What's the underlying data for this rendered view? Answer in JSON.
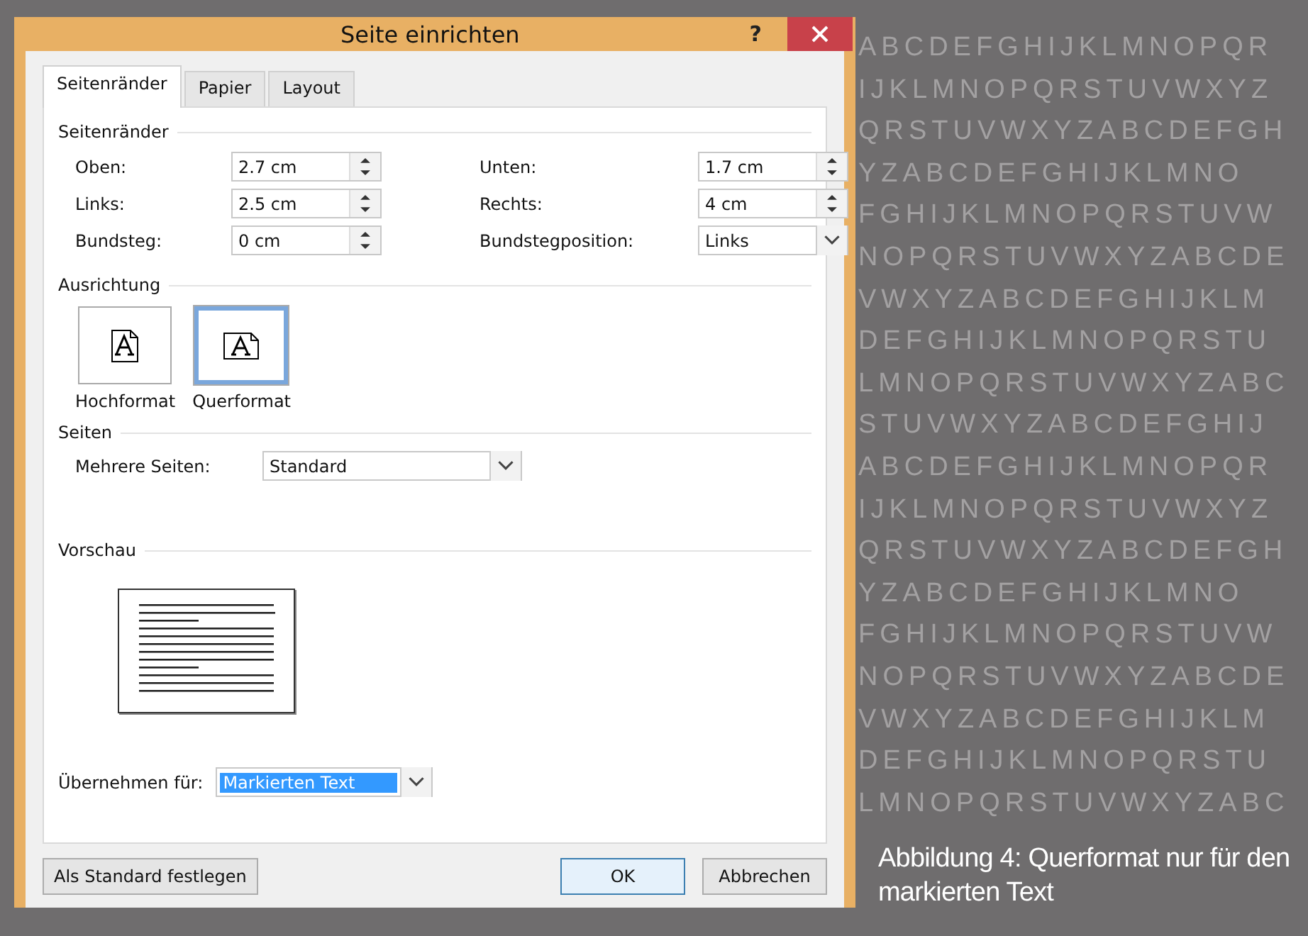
{
  "window": {
    "title": "Seite einrichten",
    "help": "?"
  },
  "tabs": [
    {
      "label": "Seitenränder",
      "selected": true
    },
    {
      "label": "Papier",
      "selected": false
    },
    {
      "label": "Layout",
      "selected": false
    }
  ],
  "margins": {
    "heading": "Seitenränder",
    "fields": [
      {
        "label": "Oben:",
        "value": "2.7 cm",
        "kind": "spin"
      },
      {
        "label": "Unten:",
        "value": "1.7 cm",
        "kind": "spin"
      },
      {
        "label": "Links:",
        "value": "2.5 cm",
        "kind": "spin"
      },
      {
        "label": "Rechts:",
        "value": "4 cm",
        "kind": "spin"
      },
      {
        "label": "Bundsteg:",
        "value": "0 cm",
        "kind": "spin"
      },
      {
        "label": "Bundstegposition:",
        "value": "Links",
        "kind": "dropdown"
      }
    ]
  },
  "orientation": {
    "heading": "Ausrichtung",
    "options": [
      {
        "label": "Hochformat",
        "kind": "portrait",
        "selected": false
      },
      {
        "label": "Querformat",
        "kind": "landscape",
        "selected": true
      }
    ]
  },
  "pages": {
    "heading": "Seiten",
    "label": "Mehrere Seiten:",
    "value": "Standard"
  },
  "preview": {
    "heading": "Vorschau"
  },
  "apply": {
    "label": "Übernehmen für:",
    "value": "Markierten Text",
    "highlighted": true
  },
  "buttons": [
    {
      "label": "Als Standard festlegen",
      "default": false
    },
    {
      "label": "OK",
      "default": true
    },
    {
      "label": "Abbrechen",
      "default": false
    }
  ],
  "background_letters": [
    "ABCDEFGHIJKLMNOPQR",
    "IJKLMNOPQRSTUVWXYZ",
    "QRSTUVWXYZABCDEFGH",
    "YZABCDEFGHIJKLMNO",
    "FGHIJKLMNOPQRSTUVW",
    "NOPQRSTUVWXYZABCDE",
    "VWXYZABCDEFGHIJKLM",
    "DEFGHIJKLMNOPQRSTU",
    "LMNOPQRSTUVWXYZABC",
    "STUVWXYZABCDEFGHIJ",
    "ABCDEFGHIJKLMNOPQR",
    "IJKLMNOPQRSTUVWXYZ",
    "QRSTUVWXYZABCDEFGH",
    "YZABCDEFGHIJKLMNO",
    "FGHIJKLMNOPQRSTUVW",
    "NOPQRSTUVWXYZABCDE",
    "VWXYZABCDEFGHIJKLM",
    "DEFGHIJKLMNOPQRSTU",
    "LMNOPQRSTUVWXYZABC"
  ],
  "caption": "Abbildung 4: Querformat nur für den markierten Text"
}
